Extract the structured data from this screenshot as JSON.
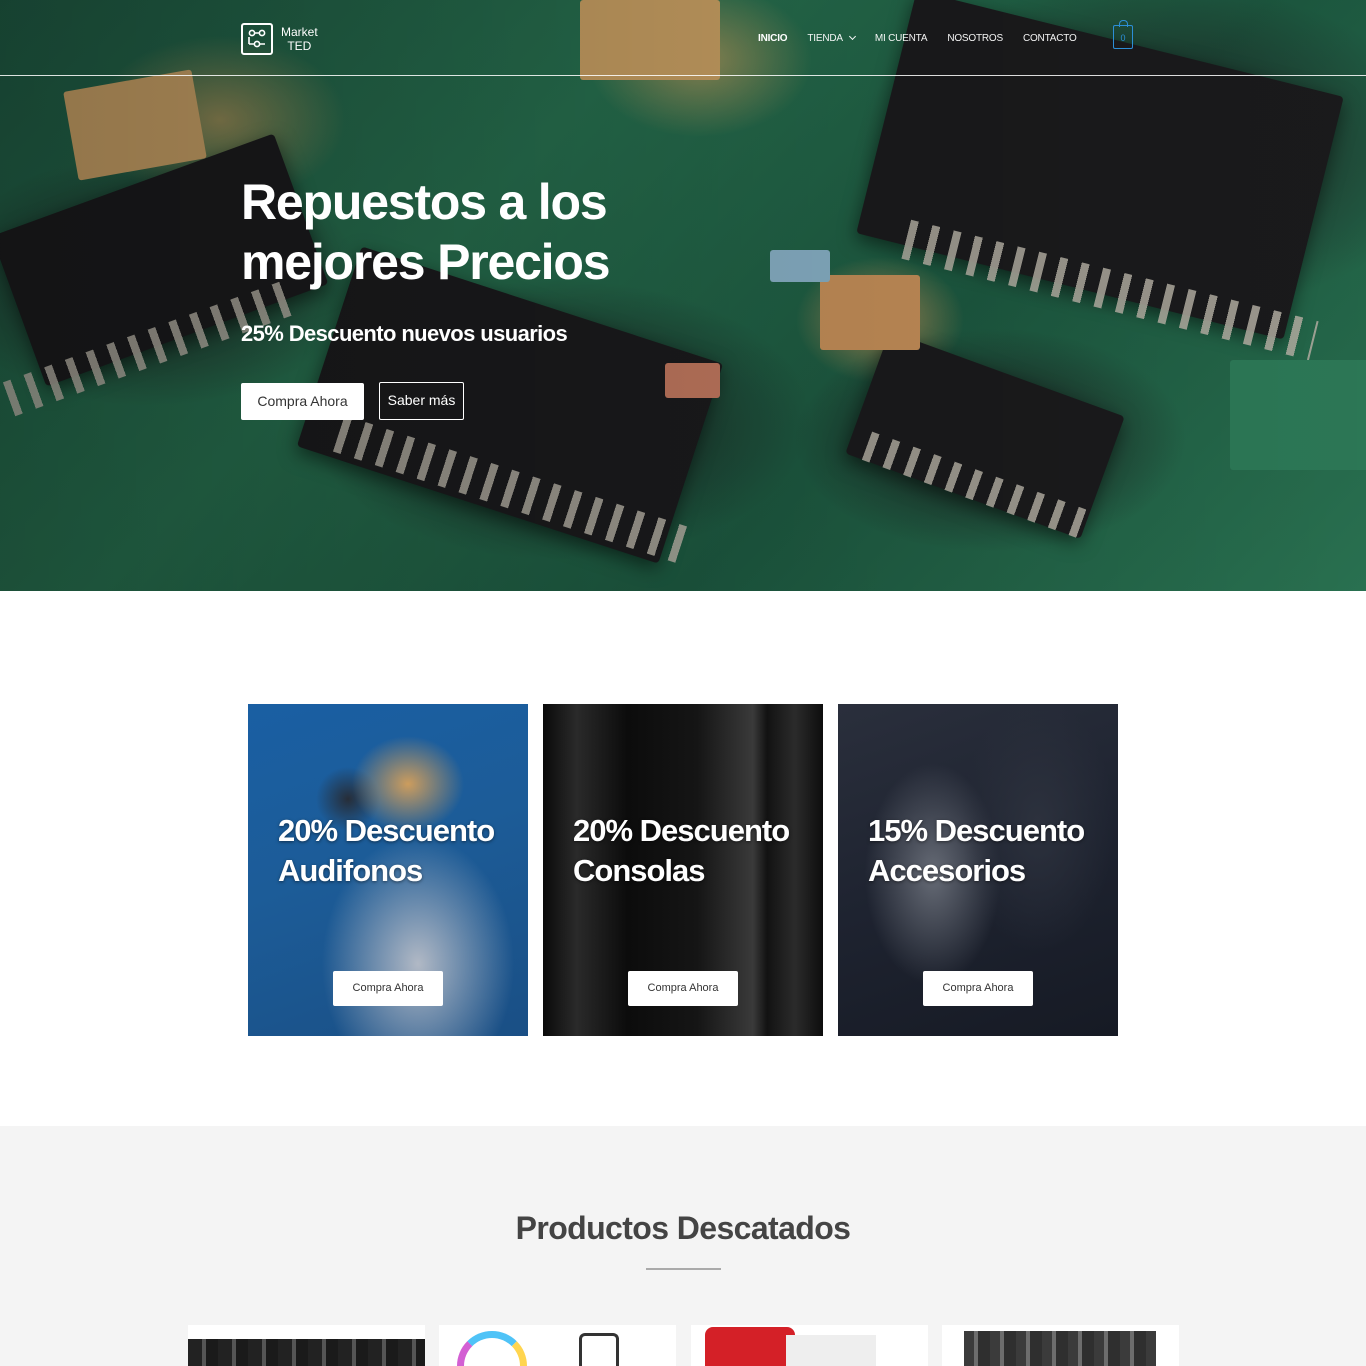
{
  "site": {
    "logo_line1": "Market",
    "logo_line2": "TED"
  },
  "nav": {
    "items": [
      {
        "label": "INICIO"
      },
      {
        "label": "TIENDA"
      },
      {
        "label": "MI CUENTA"
      },
      {
        "label": "NOSOTROS"
      },
      {
        "label": "CONTACTO"
      }
    ],
    "cart_count": "0"
  },
  "hero": {
    "title_line1": "Repuestos a los",
    "title_line2": "mejores Precios",
    "subtitle": "25% Descuento nuevos usuarios",
    "primary_button": "Compra Ahora",
    "secondary_button": "Saber más"
  },
  "promos": [
    {
      "line1": "20% Descuento",
      "line2": "Audifonos",
      "button": "Compra Ahora"
    },
    {
      "line1": "20% Descuento",
      "line2": "Consolas",
      "button": "Compra Ahora"
    },
    {
      "line1": "15% Descuento",
      "line2": "Accesorios",
      "button": "Compra Ahora"
    }
  ],
  "featured": {
    "title": "Productos Descatados"
  },
  "colors": {
    "accent": "#2c8ed6",
    "featured_bg": "#f4f4f4"
  }
}
